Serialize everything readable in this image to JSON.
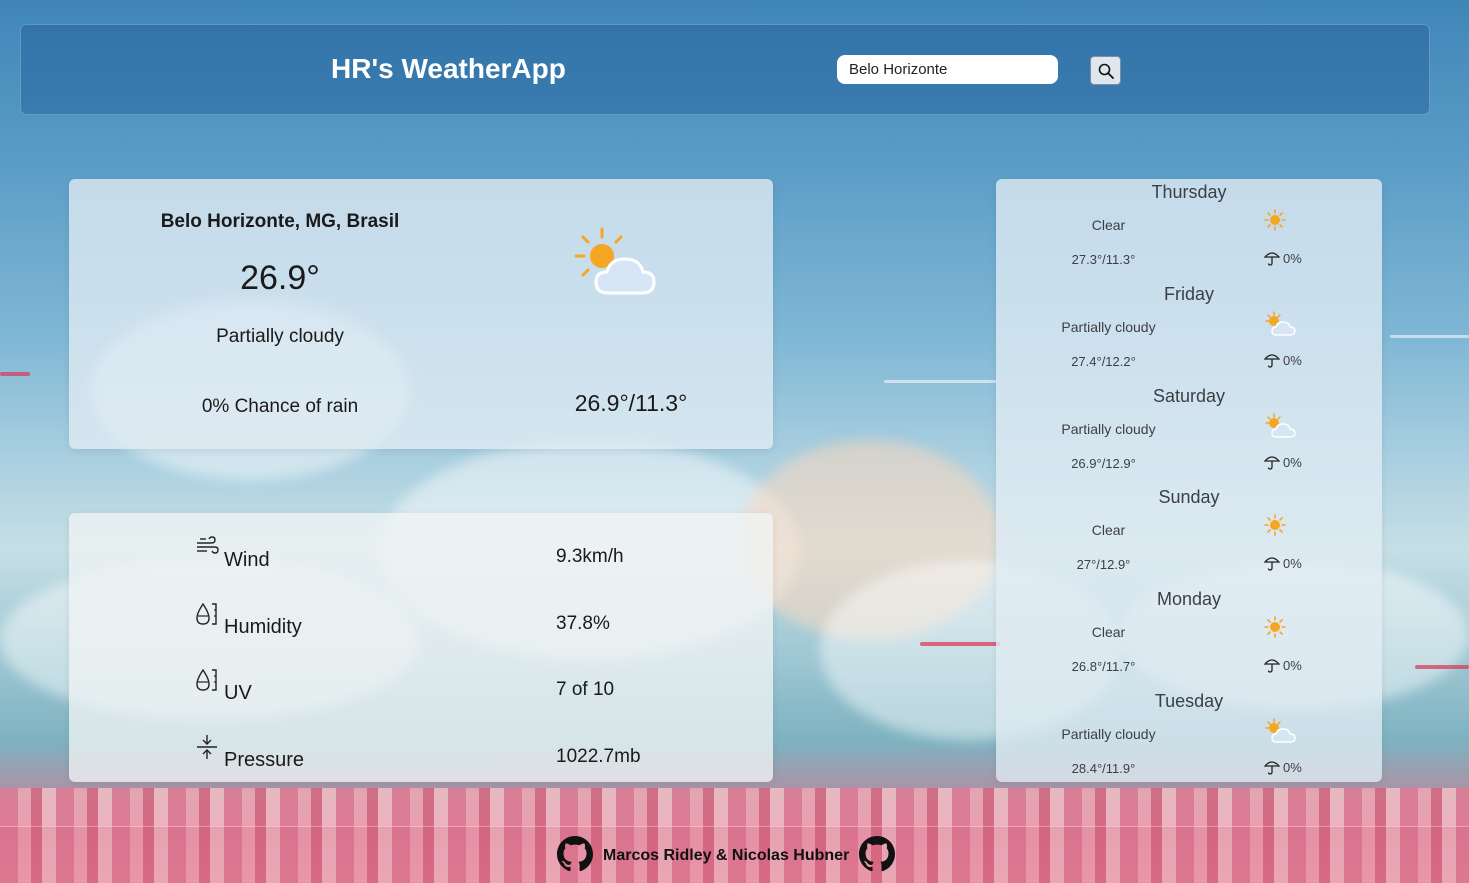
{
  "app": {
    "title": "HR's WeatherApp"
  },
  "search": {
    "value": "Belo Horizonte"
  },
  "current": {
    "location": "Belo Horizonte, MG, Brasil",
    "temperature": "26.9°",
    "condition": "Partially cloudy",
    "rain_chance": "0% Chance of rain",
    "min_max": "26.9°/11.3°",
    "icon": "partly-cloudy-icon"
  },
  "details": [
    {
      "icon": "wind-icon",
      "label": "Wind",
      "value": "9.3km/h"
    },
    {
      "icon": "humidity-icon",
      "label": "Humidity",
      "value": "37.8%"
    },
    {
      "icon": "uv-icon",
      "label": "UV",
      "value": "7 of 10"
    },
    {
      "icon": "pressure-icon",
      "label": "Pressure",
      "value": "1022.7mb"
    }
  ],
  "forecast": [
    {
      "day": "Thursday",
      "condition": "Clear",
      "temp": "27.3°/11.3°",
      "rain": "0%",
      "icon": "sun-icon"
    },
    {
      "day": "Friday",
      "condition": "Partially cloudy",
      "temp": "27.4°/12.2°",
      "rain": "0%",
      "icon": "partly-cloudy-icon"
    },
    {
      "day": "Saturday",
      "condition": "Partially cloudy",
      "temp": "26.9°/12.9°",
      "rain": "0%",
      "icon": "partly-cloudy-icon"
    },
    {
      "day": "Sunday",
      "condition": "Clear",
      "temp": "27°/12.9°",
      "rain": "0%",
      "icon": "sun-icon"
    },
    {
      "day": "Monday",
      "condition": "Clear",
      "temp": "26.8°/11.7°",
      "rain": "0%",
      "icon": "sun-icon"
    },
    {
      "day": "Tuesday",
      "condition": "Partially cloudy",
      "temp": "28.4°/11.9°",
      "rain": "0%",
      "icon": "partly-cloudy-icon"
    }
  ],
  "footer": {
    "credits": "Marcos Ridley & Nicolas Hubner"
  },
  "colors": {
    "sun": "#f5a623",
    "cloud": "#d6e6f7",
    "header": "#1e5a96"
  }
}
